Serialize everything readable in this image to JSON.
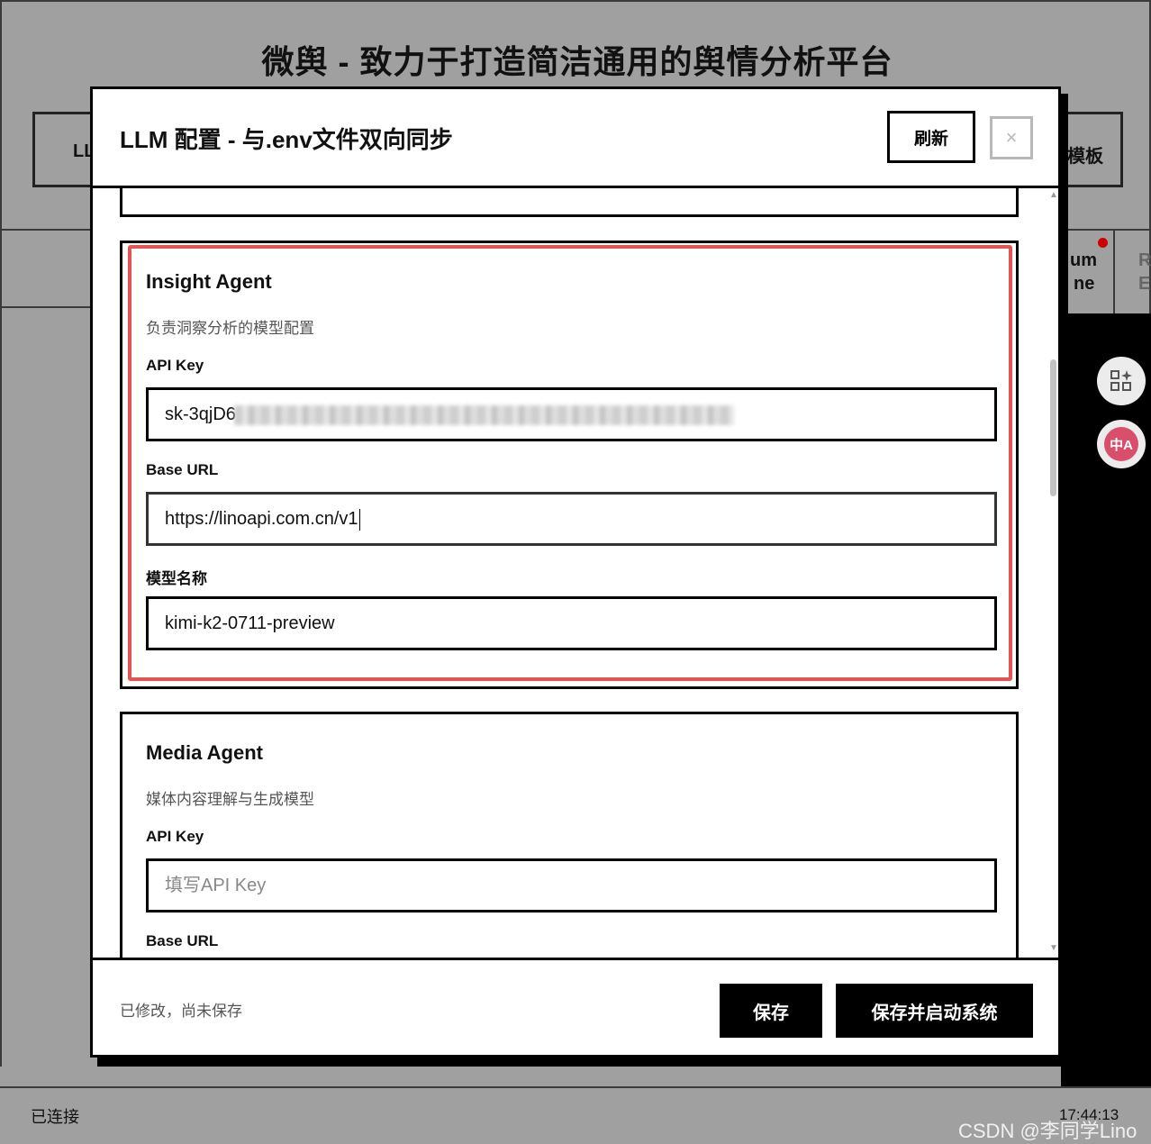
{
  "background": {
    "page_title": "微舆 - 致力于打造简洁通用的舆情分析平台",
    "tab_left_fragment": "LL",
    "tab_right_fragment": "模板",
    "engine_fragment_1a": "um",
    "engine_fragment_1b": "ne",
    "engine_fragment_2a": "R",
    "engine_fragment_2b": "E",
    "status_text": "已连接",
    "time": "17:44:13",
    "watermark": "CSDN @李同学Lino"
  },
  "modal": {
    "title": "LLM 配置 - 与.env文件双向同步",
    "refresh_label": "刷新",
    "close_symbol": "×",
    "cards": [
      {
        "title": "Insight Agent",
        "description": "负责洞察分析的模型配置",
        "api_key_label": "API Key",
        "api_key_value": "sk-3qjD6",
        "base_url_label": "Base URL",
        "base_url_value": "https://linoapi.com.cn/v1",
        "model_label": "模型名称",
        "model_value": "kimi-k2-0711-preview"
      },
      {
        "title": "Media Agent",
        "description": "媒体内容理解与生成模型",
        "api_key_label": "API Key",
        "api_key_placeholder": "填写API Key",
        "base_url_label": "Base URL"
      }
    ],
    "footer": {
      "status": "已修改，尚未保存",
      "save_label": "保存",
      "save_start_label": "保存并启动系统"
    }
  },
  "icons": {
    "apps": "apps-sparkle-icon",
    "translate": "translate-icon",
    "translate_glyph": "中A"
  },
  "colors": {
    "highlight": "#e55353",
    "primary_button": "#000000",
    "notification_dot": "#cc0000"
  }
}
